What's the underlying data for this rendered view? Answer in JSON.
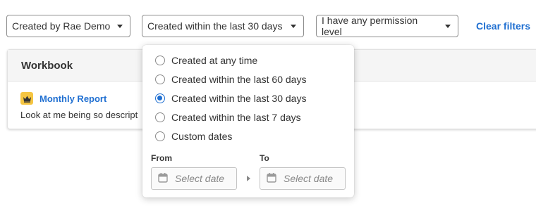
{
  "filters": {
    "owner": {
      "label": "Created by Rae Demo"
    },
    "created": {
      "label": "Created within the last 30 days"
    },
    "permission": {
      "label": "I have any permission level"
    },
    "clear_label": "Clear filters"
  },
  "results": {
    "header": "Workbook",
    "item": {
      "title": "Monthly Report",
      "description": "Look at me being so descript",
      "icon": "crown-icon"
    }
  },
  "dropdown": {
    "options": [
      {
        "label": "Created at any time",
        "checked": false
      },
      {
        "label": "Created within the last 60 days",
        "checked": false
      },
      {
        "label": "Created within the last 30 days",
        "checked": true
      },
      {
        "label": "Created within the last 7 days",
        "checked": false
      },
      {
        "label": "Custom dates",
        "checked": false
      }
    ],
    "from_label": "From",
    "to_label": "To",
    "from_placeholder": "Select date",
    "to_placeholder": "Select date"
  },
  "colors": {
    "accent": "#1f6fd1",
    "badge": "#f5c542"
  }
}
